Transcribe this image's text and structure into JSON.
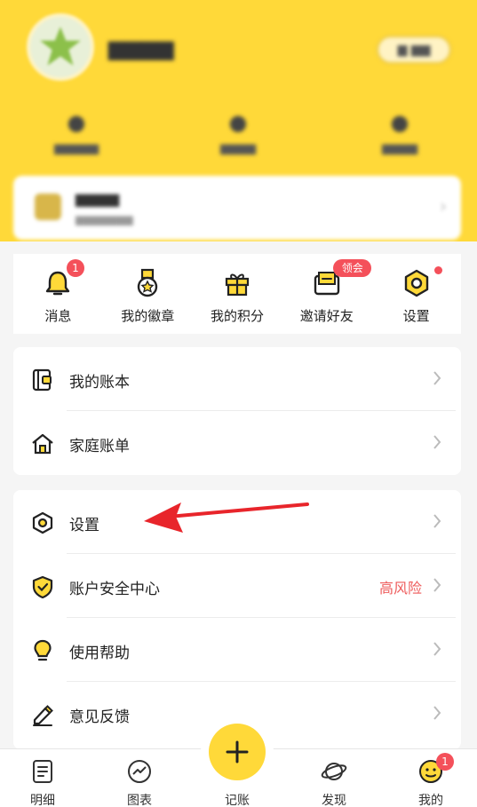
{
  "quick_actions": [
    {
      "label": "消息",
      "badge": "1"
    },
    {
      "label": "我的徽章"
    },
    {
      "label": "我的积分"
    },
    {
      "label": "邀请好友",
      "badge": "领会员"
    },
    {
      "label": "设置"
    }
  ],
  "book_section": [
    {
      "label": "我的账本"
    },
    {
      "label": "家庭账单"
    }
  ],
  "settings_section": [
    {
      "label": "设置"
    },
    {
      "label": "账户安全中心",
      "status": "高风险"
    },
    {
      "label": "使用帮助"
    },
    {
      "label": "意见反馈"
    }
  ],
  "tabbar": {
    "details": "明细",
    "charts": "图表",
    "record": "记账",
    "discover": "发现",
    "mine": "我的",
    "mine_badge": "1"
  },
  "colors": {
    "brand_yellow": "#ffd939",
    "badge_red": "#f4505a",
    "risk_red": "#ee5a5a",
    "annotation_arrow": "#e8252b"
  }
}
